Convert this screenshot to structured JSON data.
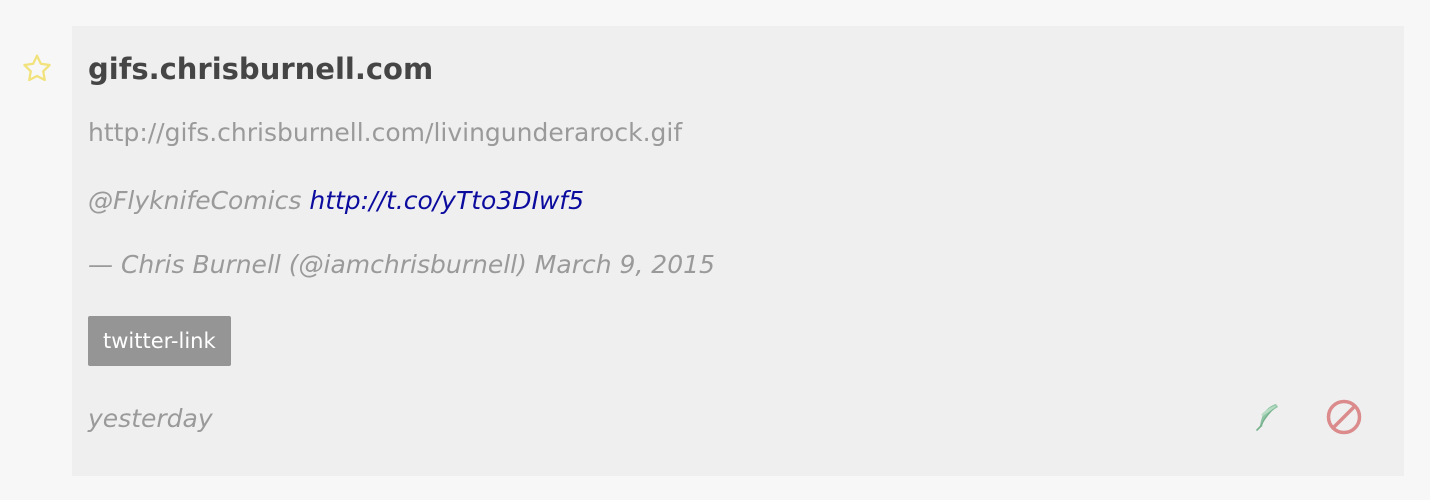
{
  "bookmark": {
    "favorite_icon": "star-outline-icon",
    "favorite_color": "#f2e27b",
    "title": "gifs.chrisburnell.com",
    "url": "http://gifs.chrisburnell.com/livingunderarock.gif",
    "quote": {
      "mention": "@FlyknifeComics",
      "link": "http://t.co/yTto3DIwf5",
      "attribution": "— Chris Burnell (@iamchrisburnell) March 9, 2015"
    },
    "tags": [
      "twitter-link"
    ],
    "timestamp": "yesterday",
    "actions": {
      "tweet_icon": "feather-icon",
      "tweet_color": "#8fc4a4",
      "block_icon": "prohibit-icon",
      "block_color": "#db8b8b"
    }
  }
}
